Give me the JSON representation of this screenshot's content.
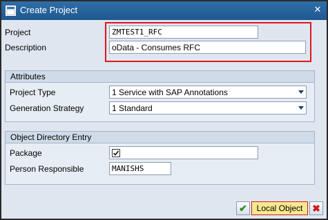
{
  "window": {
    "title": "Create Project",
    "icons": {
      "app": "sap-window-icon",
      "close": "close-icon"
    }
  },
  "header_fields": {
    "project_label": "Project",
    "project_value": "ZMTEST1_RFC",
    "description_label": "Description",
    "description_value": "oData - Consumes RFC",
    "highlight_color": "#e0151d"
  },
  "attributes": {
    "title": "Attributes",
    "project_type_label": "Project Type",
    "project_type_value": "1 Service with SAP Annotations",
    "generation_strategy_label": "Generation Strategy",
    "generation_strategy_value": "1 Standard"
  },
  "object_directory": {
    "title": "Object Directory Entry",
    "package_label": "Package",
    "package_value_icon": "checkbox-check-icon",
    "person_label": "Person Responsible",
    "person_value": "MANISHS"
  },
  "footer": {
    "accept_glyph": "✔",
    "local_object_label": "Local Object",
    "cancel_glyph": "✖"
  },
  "colors": {
    "titlebar": "#1f5890",
    "panel": "#dfe6ef",
    "accent_red": "#e0151d",
    "button_highlight": "#f7e88f"
  }
}
